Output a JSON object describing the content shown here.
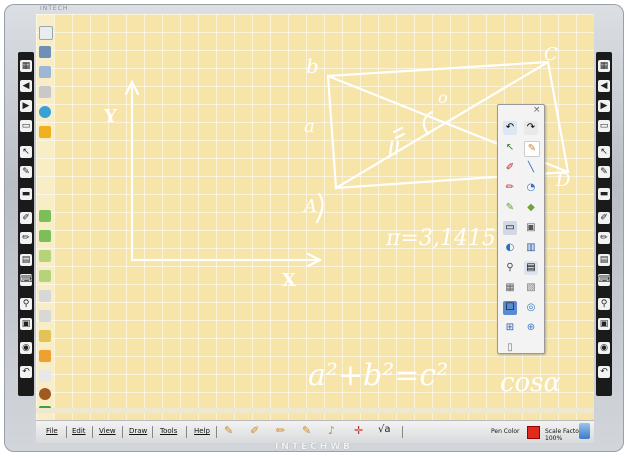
{
  "frame": {
    "top_title": "INTECH",
    "brand": "INTECHWB"
  },
  "board": {
    "y_axis_label": "Y",
    "x_axis_label": "X",
    "handwriting": {
      "vertex_b": "b",
      "vertex_c": "C",
      "vertex_d": "D",
      "vertex_a": "A",
      "side_a": "a",
      "side_o": "o",
      "pi_formula": "π=3,1415",
      "pythagoras": "a²+b²=c²",
      "cos": "cosα"
    }
  },
  "menubar": {
    "items": [
      "File",
      "Edit",
      "View",
      "Draw",
      "Tools",
      "Help"
    ]
  },
  "bottom_tools": [
    "pencil-tool",
    "highlighter-tool",
    "marker-tool",
    "pen-tool",
    "brush-tool",
    "axes-tool",
    "sqrt-tool"
  ],
  "sqrt_label": "√a",
  "pen_color_label": "Pen Color",
  "pen_color": "#e02a1a",
  "scale_factor_label": "Scale Factor 100%",
  "palette": {
    "close_glyph": "×",
    "tools": [
      "undo",
      "redo",
      "select",
      "pen",
      "eraser",
      "line",
      "highlighter",
      "text",
      "marker",
      "fill",
      "laser",
      "camera",
      "spotlight",
      "screen",
      "dropper",
      "keyboard",
      "shape",
      "record",
      "settings",
      "zoom",
      "clock",
      "recycle",
      "mouse",
      "hand"
    ]
  },
  "colors": {
    "board": "#f6e4a8",
    "ink": "#ffffff",
    "bezel": "#c7ccd2",
    "sidebar": "#1a1a1a"
  }
}
